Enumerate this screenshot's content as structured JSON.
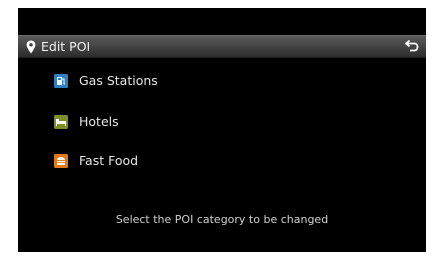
{
  "header": {
    "title": "Edit POI",
    "left_icon": "location-pin-icon",
    "right_icon": "back-arrow-icon"
  },
  "categories": [
    {
      "label": "Gas Stations",
      "icon": "gas-station-icon",
      "color": "#2f7fc1"
    },
    {
      "label": "Hotels",
      "icon": "hotel-icon",
      "color": "#7d8f2c"
    },
    {
      "label": "Fast Food",
      "icon": "fast-food-icon",
      "color": "#e07a1a"
    }
  ],
  "hint": "Select the POI category to be changed",
  "colors": {
    "screen_background": "#000000",
    "header_background": "#414141",
    "text": "#e6e6e6"
  }
}
